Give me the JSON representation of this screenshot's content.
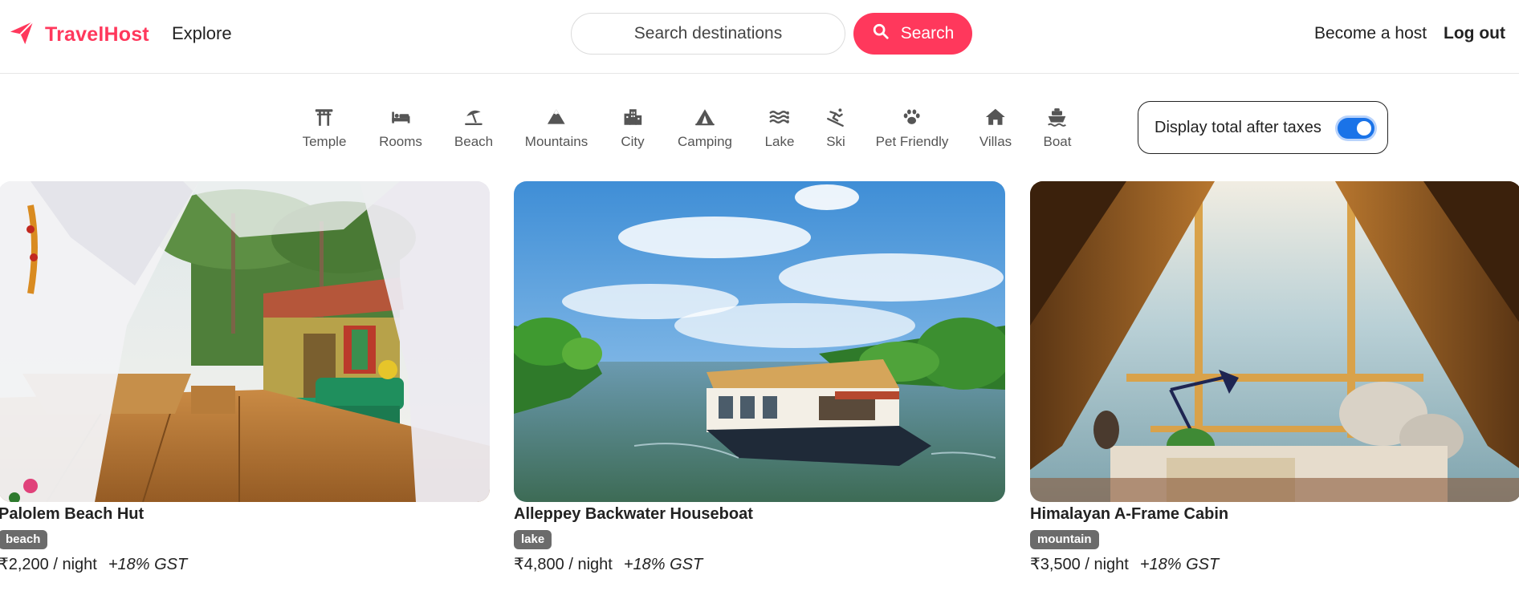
{
  "header": {
    "logo_text": "TravelHost",
    "explore": "Explore",
    "search_placeholder": "Search destinations",
    "search_button": "Search",
    "become_host": "Become a host",
    "logout": "Log out",
    "brand_color": "#ff385c"
  },
  "categories": [
    {
      "label": "Temple",
      "icon": "torii-icon"
    },
    {
      "label": "Rooms",
      "icon": "bed-icon"
    },
    {
      "label": "Beach",
      "icon": "umbrella-beach-icon"
    },
    {
      "label": "Mountains",
      "icon": "mountain-icon"
    },
    {
      "label": "City",
      "icon": "city-icon"
    },
    {
      "label": "Camping",
      "icon": "tent-icon"
    },
    {
      "label": "Lake",
      "icon": "water-icon"
    },
    {
      "label": "Ski",
      "icon": "skiing-icon"
    },
    {
      "label": "Pet Friendly",
      "icon": "paw-icon"
    },
    {
      "label": "Villas",
      "icon": "house-icon"
    },
    {
      "label": "Boat",
      "icon": "ship-icon"
    }
  ],
  "tax_toggle": {
    "label": "Display total after taxes",
    "enabled": true,
    "accent": "#1a73e8"
  },
  "listings": [
    {
      "title": "Palolem Beach Hut",
      "tag": "beach",
      "price": "₹2,200",
      "per": " / night",
      "tax_note": "+18% GST"
    },
    {
      "title": "Alleppey Backwater Houseboat",
      "tag": "lake",
      "price": "₹4,800",
      "per": " / night",
      "tax_note": "+18% GST"
    },
    {
      "title": "Himalayan A-Frame Cabin",
      "tag": "mountain",
      "price": "₹3,500",
      "per": " / night",
      "tax_note": "+18% GST"
    }
  ]
}
